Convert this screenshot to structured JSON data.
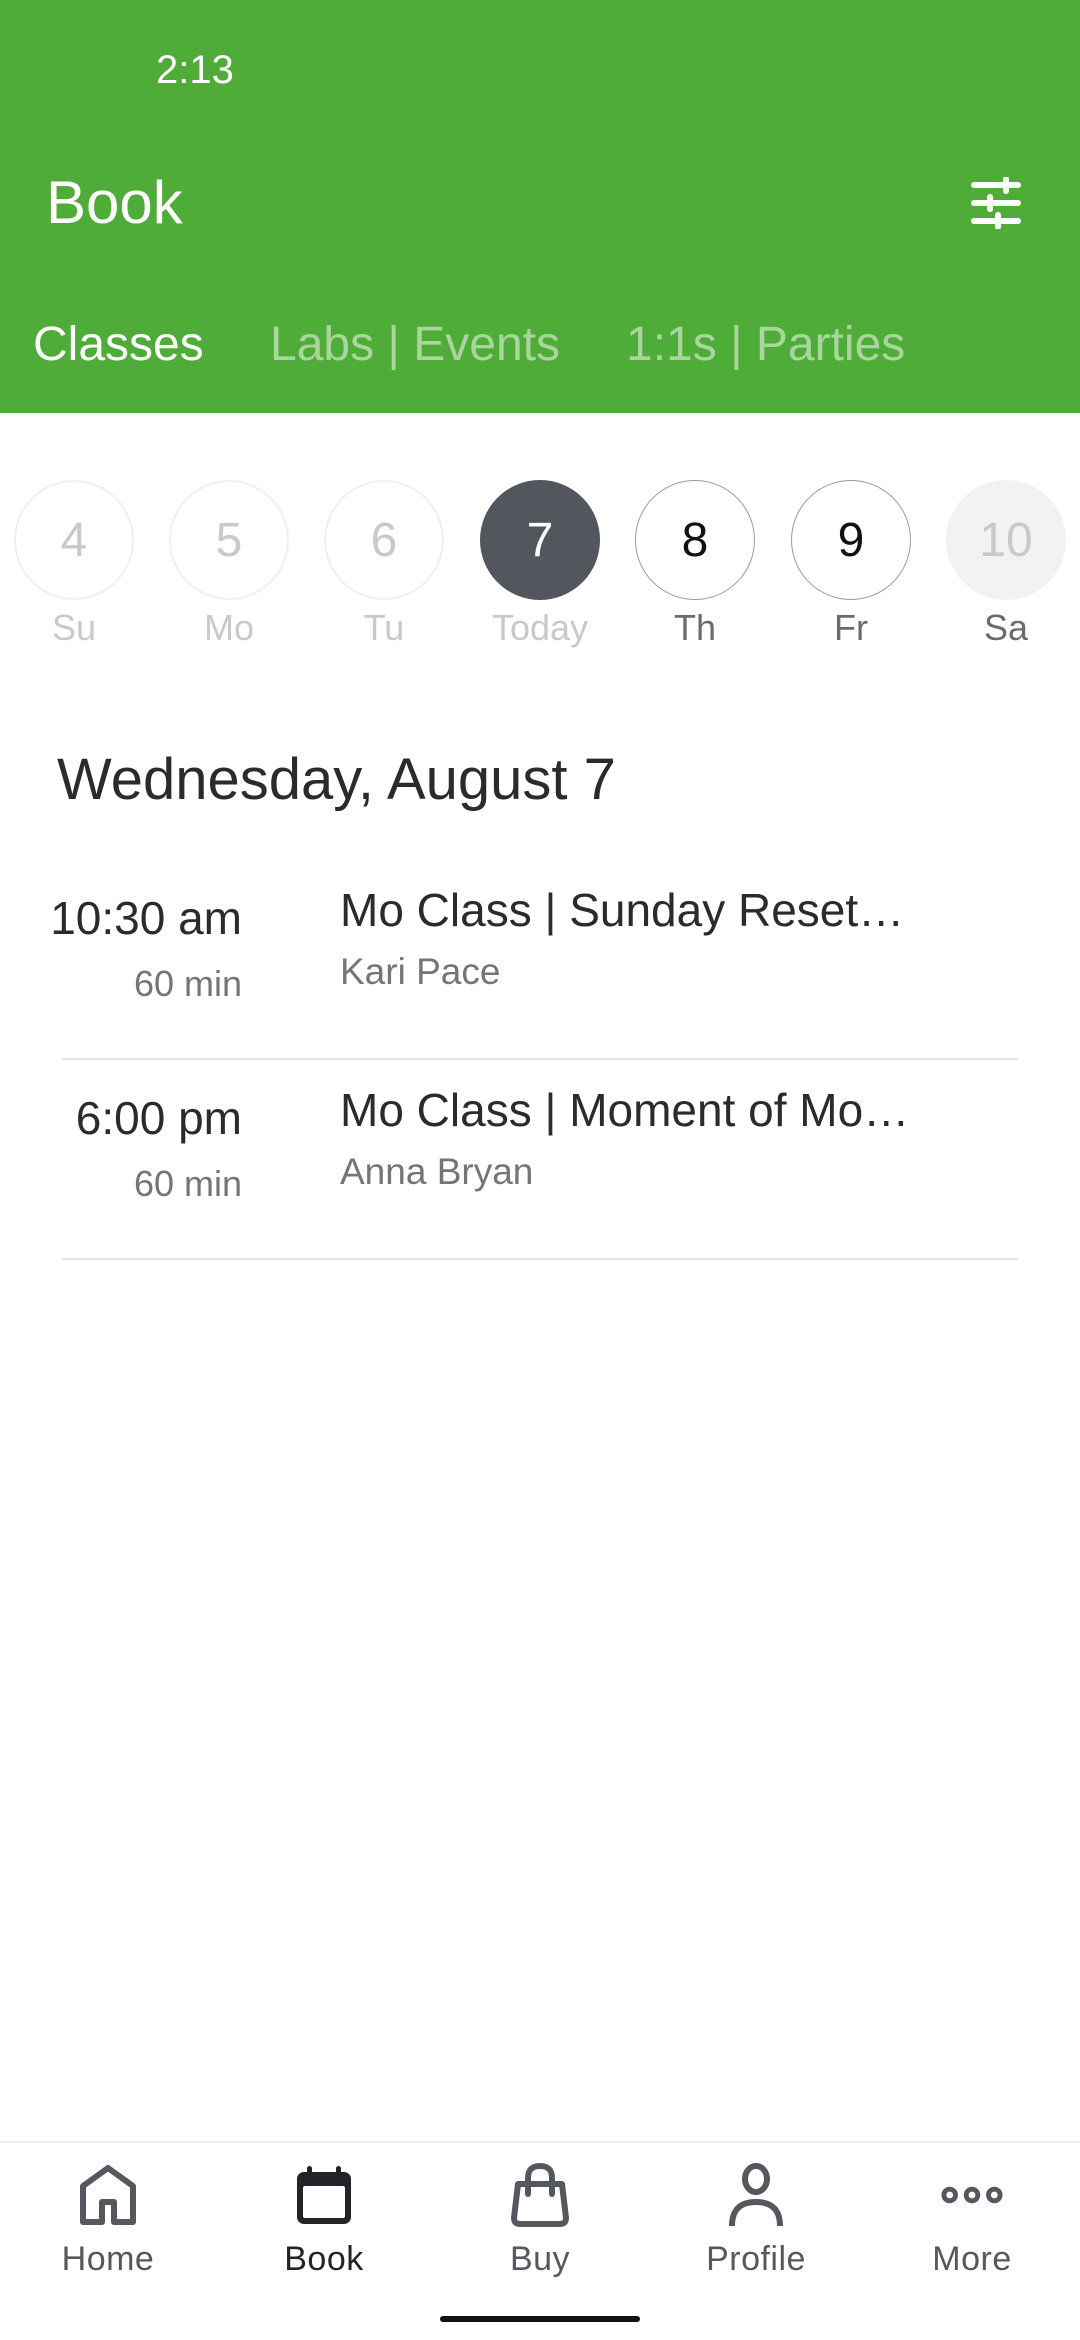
{
  "status_bar": {
    "time": "2:13"
  },
  "header": {
    "title": "Book",
    "filter_icon": "sliders-icon",
    "background_color": "#50ac38"
  },
  "tabs": [
    {
      "label": "Classes",
      "active": true
    },
    {
      "label": "Labs | Events",
      "active": false
    },
    {
      "label": "1:1s | Parties",
      "active": false
    }
  ],
  "date_strip": [
    {
      "number": "4",
      "label": "Su",
      "state": "past"
    },
    {
      "number": "5",
      "label": "Mo",
      "state": "past"
    },
    {
      "number": "6",
      "label": "Tu",
      "state": "past"
    },
    {
      "number": "7",
      "label": "Today",
      "state": "today"
    },
    {
      "number": "8",
      "label": "Th",
      "state": "future"
    },
    {
      "number": "9",
      "label": "Fr",
      "state": "future"
    },
    {
      "number": "10",
      "label": "Sa",
      "state": "disabled"
    }
  ],
  "selected_date_heading": "Wednesday, August 7",
  "classes": [
    {
      "time": "10:30 am",
      "duration": "60 min",
      "name": "Mo Class | Sunday Reset…",
      "instructor": "Kari Pace"
    },
    {
      "time": "6:00 pm",
      "duration": "60 min",
      "name": "Mo Class | Moment of Mo…",
      "instructor": "Anna Bryan"
    }
  ],
  "bottom_nav": [
    {
      "label": "Home",
      "icon": "home-icon",
      "active": false
    },
    {
      "label": "Book",
      "icon": "calendar-icon",
      "active": true
    },
    {
      "label": "Buy",
      "icon": "shopping-bag-icon",
      "active": false
    },
    {
      "label": "Profile",
      "icon": "person-icon",
      "active": false
    },
    {
      "label": "More",
      "icon": "more-dots-icon",
      "active": false
    }
  ]
}
